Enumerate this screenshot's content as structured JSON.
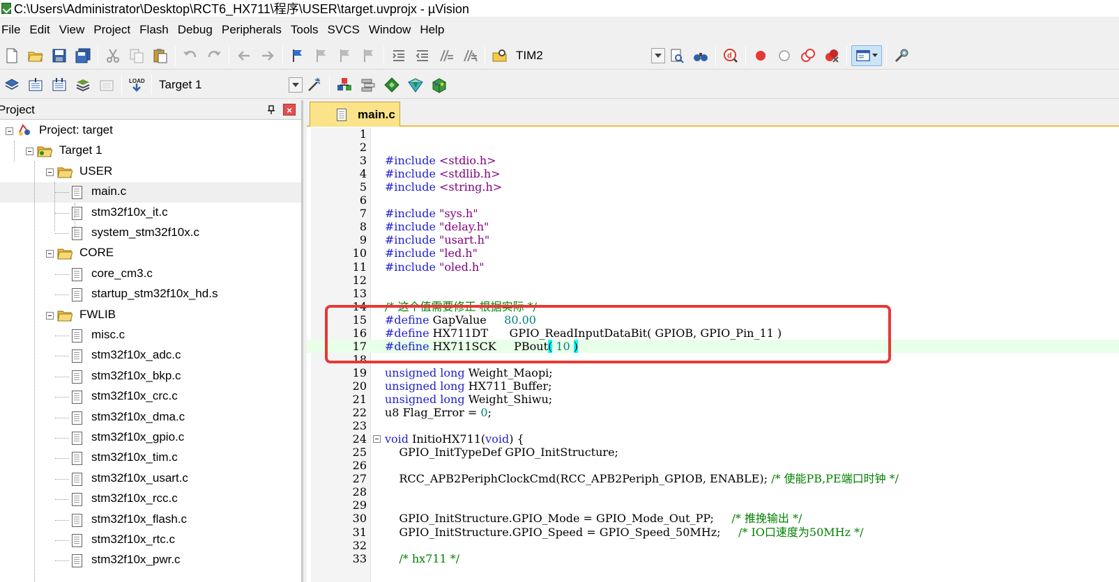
{
  "window": {
    "title": "C:\\Users\\Administrator\\Desktop\\RCT6_HX711\\程序\\USER\\target.uvprojx - µVision"
  },
  "menu": [
    "File",
    "Edit",
    "View",
    "Project",
    "Flash",
    "Debug",
    "Peripherals",
    "Tools",
    "SVCS",
    "Window",
    "Help"
  ],
  "toolbar1": {
    "find_combo_value": "TIM2"
  },
  "toolbar2": {
    "load_label": "LOAD",
    "target_combo_value": "Target 1"
  },
  "project_panel": {
    "title": "Project",
    "pin_glyph": "ᵖ",
    "close_glyph": "×",
    "root": "Project: target",
    "target": "Target 1",
    "groups": [
      {
        "name": "USER",
        "files": [
          "main.c",
          "stm32f10x_it.c",
          "system_stm32f10x.c"
        ]
      },
      {
        "name": "CORE",
        "files": [
          "core_cm3.c",
          "startup_stm32f10x_hd.s"
        ]
      },
      {
        "name": "FWLIB",
        "files": [
          "misc.c",
          "stm32f10x_adc.c",
          "stm32f10x_bkp.c",
          "stm32f10x_crc.c",
          "stm32f10x_dma.c",
          "stm32f10x_gpio.c",
          "stm32f10x_tim.c",
          "stm32f10x_usart.c",
          "stm32f10x_rcc.c",
          "stm32f10x_flash.c",
          "stm32f10x_rtc.c",
          "stm32f10x_pwr.c"
        ]
      }
    ],
    "selected_file": "main.c"
  },
  "editor": {
    "active_tab": "main.c",
    "current_line": 17,
    "lines": [
      {
        "n": "1",
        "code": ""
      },
      {
        "n": "2",
        "code": ""
      },
      {
        "n": "3",
        "code": "#include <stdio.h>"
      },
      {
        "n": "4",
        "code": "#include <stdlib.h>"
      },
      {
        "n": "5",
        "code": "#include <string.h>"
      },
      {
        "n": "6",
        "code": ""
      },
      {
        "n": "7",
        "code": "#include \"sys.h\""
      },
      {
        "n": "8",
        "code": "#include \"delay.h\""
      },
      {
        "n": "9",
        "code": "#include \"usart.h\""
      },
      {
        "n": "10",
        "code": "#include \"led.h\""
      },
      {
        "n": "11",
        "code": "#include \"oled.h\""
      },
      {
        "n": "12",
        "code": ""
      },
      {
        "n": "13",
        "code": ""
      },
      {
        "n": "14",
        "code": "/* 这个值需要修正 根据实际 */"
      },
      {
        "n": "15",
        "code": "#define GapValue     80.00"
      },
      {
        "n": "16",
        "code": "#define HX711DT      GPIO_ReadInputDataBit( GPIOB, GPIO_Pin_11 )"
      },
      {
        "n": "17",
        "code": "#define HX711SCK     PBout( 10 )"
      },
      {
        "n": "18",
        "code": ""
      },
      {
        "n": "19",
        "code": "unsigned long Weight_Maopi;"
      },
      {
        "n": "20",
        "code": "unsigned long HX711_Buffer;"
      },
      {
        "n": "21",
        "code": "unsigned long Weight_Shiwu;"
      },
      {
        "n": "22",
        "code": "u8 Flag_Error = 0;"
      },
      {
        "n": "23",
        "code": ""
      },
      {
        "n": "24",
        "code": "void InitioHX711(void) {"
      },
      {
        "n": "25",
        "code": "    GPIO_InitTypeDef GPIO_InitStructure;"
      },
      {
        "n": "26",
        "code": ""
      },
      {
        "n": "27",
        "code": "    RCC_APB2PeriphClockCmd(RCC_APB2Periph_GPIOB, ENABLE); /* 使能PB,PE端口时钟 */"
      },
      {
        "n": "28",
        "code": ""
      },
      {
        "n": "29",
        "code": ""
      },
      {
        "n": "30",
        "code": "    GPIO_InitStructure.GPIO_Mode = GPIO_Mode_Out_PP;     /* 推挽输出 */"
      },
      {
        "n": "31",
        "code": "    GPIO_InitStructure.GPIO_Speed = GPIO_Speed_50MHz;     /* IO口速度为50MHz */"
      },
      {
        "n": "32",
        "code": ""
      },
      {
        "n": "33",
        "code": "    /* hx711 */"
      }
    ]
  },
  "colors": {
    "keyword": "#1f1fd0",
    "string": "#800080",
    "number": "#008080",
    "comment": "#008000",
    "highlight_box": "#e53935",
    "current_line": "#e8ffe8"
  }
}
